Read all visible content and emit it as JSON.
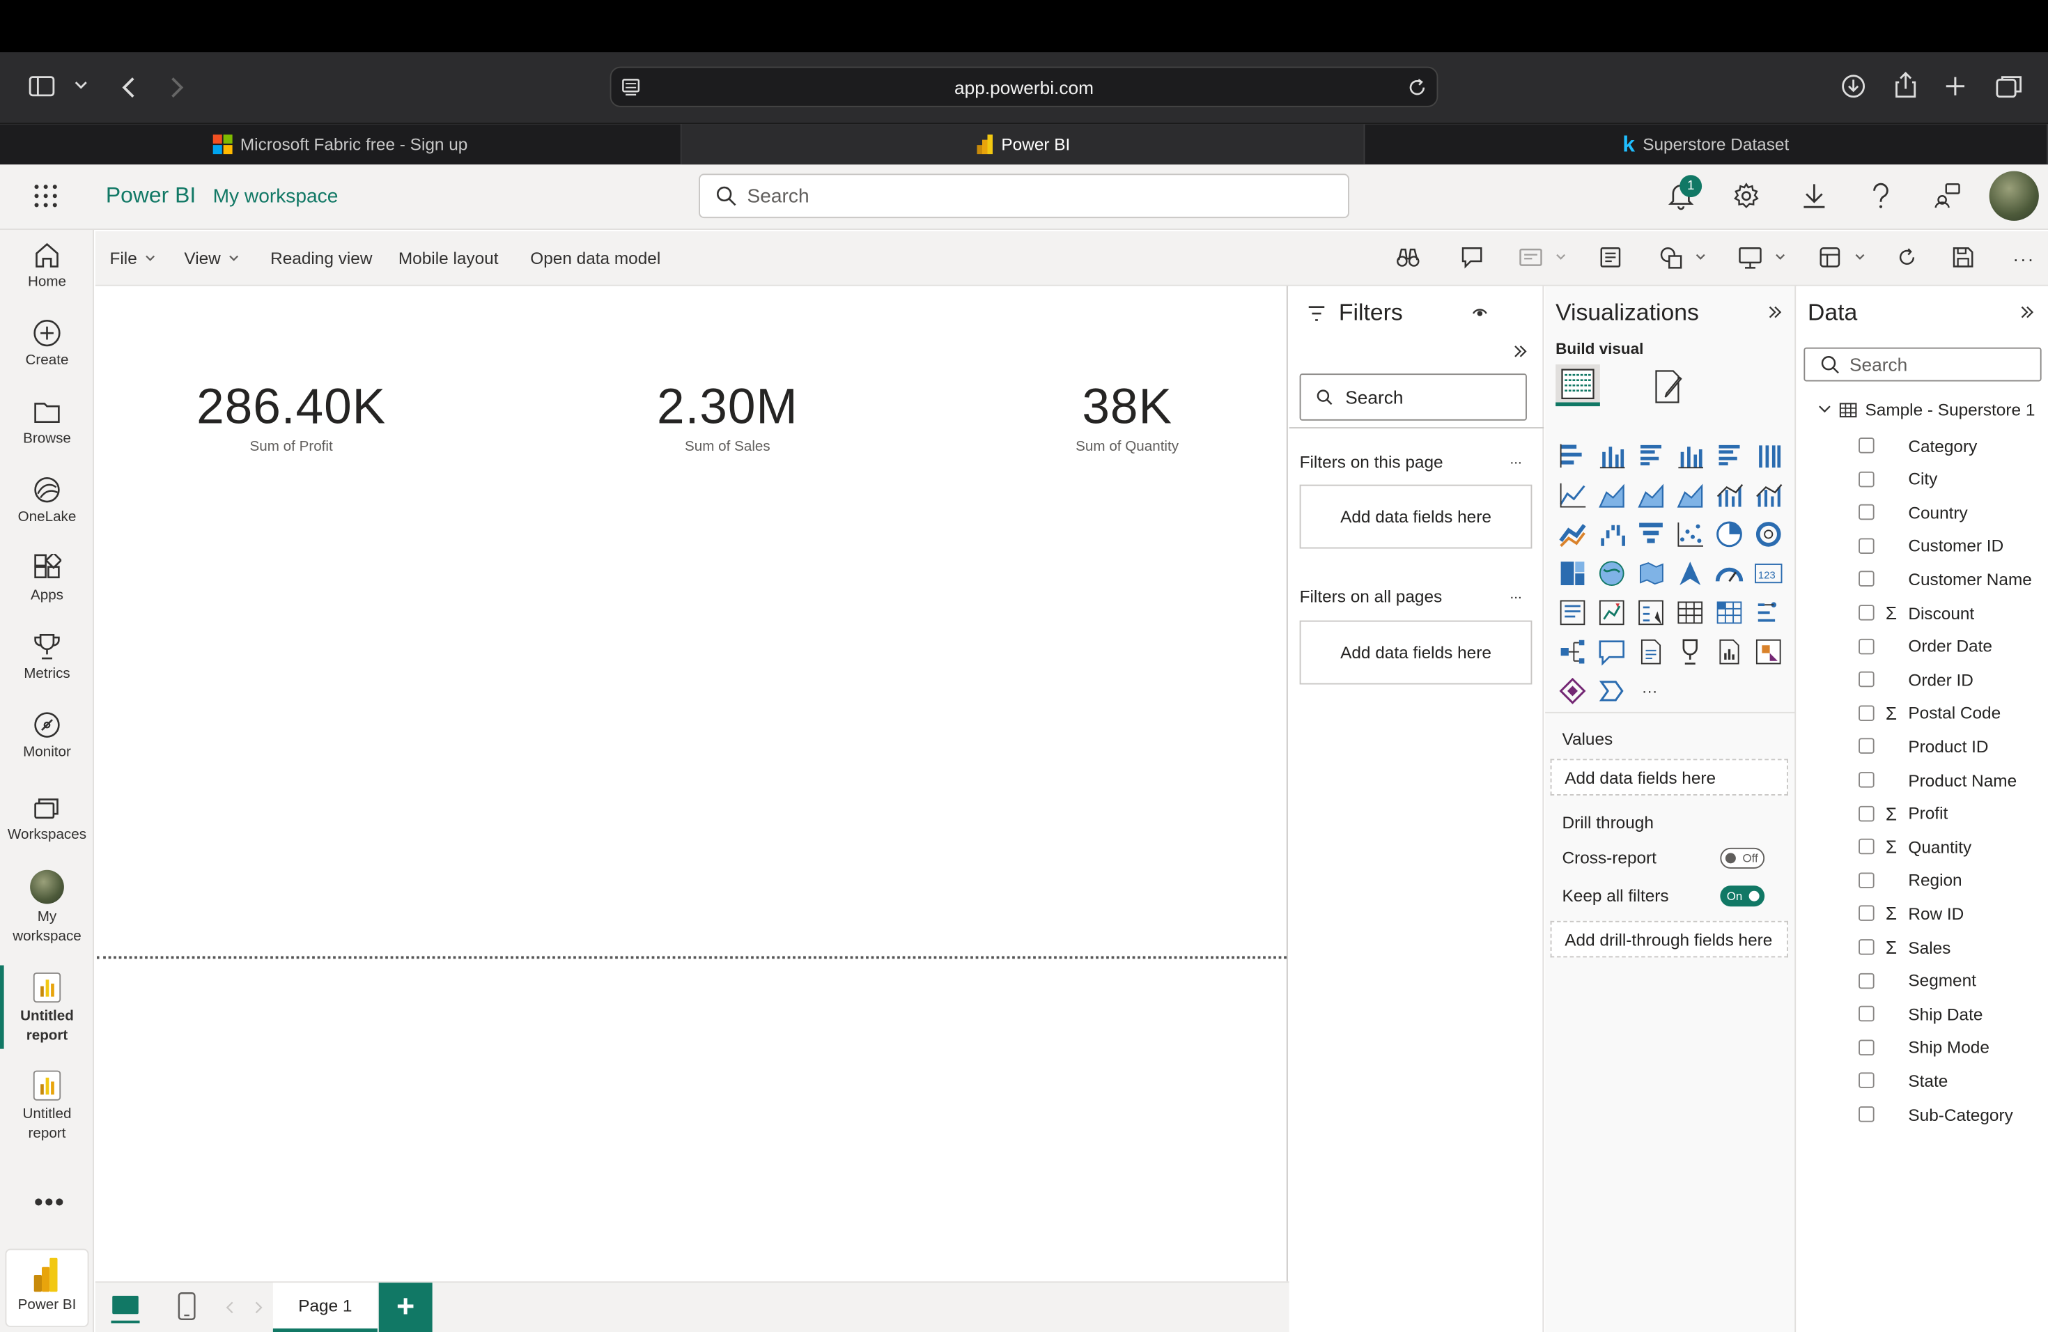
{
  "browser": {
    "url": "app.powerbi.com",
    "tabs": [
      {
        "label": "Microsoft Fabric free - Sign up"
      },
      {
        "label": "Power BI"
      },
      {
        "label": "Superstore Dataset"
      }
    ]
  },
  "app": {
    "brand": "Power BI",
    "workspace": "My workspace",
    "search_placeholder": "Search",
    "notification_count": "1"
  },
  "nav": {
    "items": [
      {
        "label": "Home"
      },
      {
        "label": "Create"
      },
      {
        "label": "Browse"
      },
      {
        "label": "OneLake"
      },
      {
        "label": "Apps"
      },
      {
        "label": "Metrics"
      },
      {
        "label": "Monitor"
      },
      {
        "label": "Workspaces"
      },
      {
        "label": "My workspace"
      },
      {
        "label": "Untitled report"
      },
      {
        "label": "Untitled report"
      },
      {
        "label": "Power BI"
      }
    ]
  },
  "ribbon": {
    "file": "File",
    "view": "View",
    "reading_view": "Reading view",
    "mobile_layout": "Mobile layout",
    "open_data_model": "Open data model"
  },
  "cards": [
    {
      "value": "286.40K",
      "label": "Sum of Profit"
    },
    {
      "value": "2.30M",
      "label": "Sum of Sales"
    },
    {
      "value": "38K",
      "label": "Sum of Quantity"
    }
  ],
  "pages": {
    "current": "Page 1",
    "add": "+"
  },
  "filters": {
    "title": "Filters",
    "search_placeholder": "Search",
    "on_this_page": "Filters on this page",
    "on_all_pages": "Filters on all pages",
    "add_fields": "Add data fields here",
    "more": "..."
  },
  "visualizations": {
    "title": "Visualizations",
    "build_visual": "Build visual",
    "values": "Values",
    "add_fields": "Add data fields here",
    "drill_through": "Drill through",
    "cross_report": "Cross-report",
    "cross_report_state": "Off",
    "keep_all_filters": "Keep all filters",
    "keep_all_filters_state": "On",
    "add_drill_fields": "Add drill-through fields here",
    "more": "...",
    "accent_color": "#117865"
  },
  "data": {
    "title": "Data",
    "search_placeholder": "Search",
    "table_name": "Sample - Superstore 1",
    "fields": [
      {
        "name": "Category",
        "sigma": ""
      },
      {
        "name": "City",
        "sigma": ""
      },
      {
        "name": "Country",
        "sigma": ""
      },
      {
        "name": "Customer ID",
        "sigma": ""
      },
      {
        "name": "Customer Name",
        "sigma": ""
      },
      {
        "name": "Discount",
        "sigma": "Σ"
      },
      {
        "name": "Order Date",
        "sigma": ""
      },
      {
        "name": "Order ID",
        "sigma": ""
      },
      {
        "name": "Postal Code",
        "sigma": "Σ"
      },
      {
        "name": "Product ID",
        "sigma": ""
      },
      {
        "name": "Product Name",
        "sigma": ""
      },
      {
        "name": "Profit",
        "sigma": "Σ"
      },
      {
        "name": "Quantity",
        "sigma": "Σ"
      },
      {
        "name": "Region",
        "sigma": ""
      },
      {
        "name": "Row ID",
        "sigma": "Σ"
      },
      {
        "name": "Sales",
        "sigma": "Σ"
      },
      {
        "name": "Segment",
        "sigma": ""
      },
      {
        "name": "Ship Date",
        "sigma": ""
      },
      {
        "name": "Ship Mode",
        "sigma": ""
      },
      {
        "name": "State",
        "sigma": ""
      },
      {
        "name": "Sub-Category",
        "sigma": ""
      }
    ]
  }
}
